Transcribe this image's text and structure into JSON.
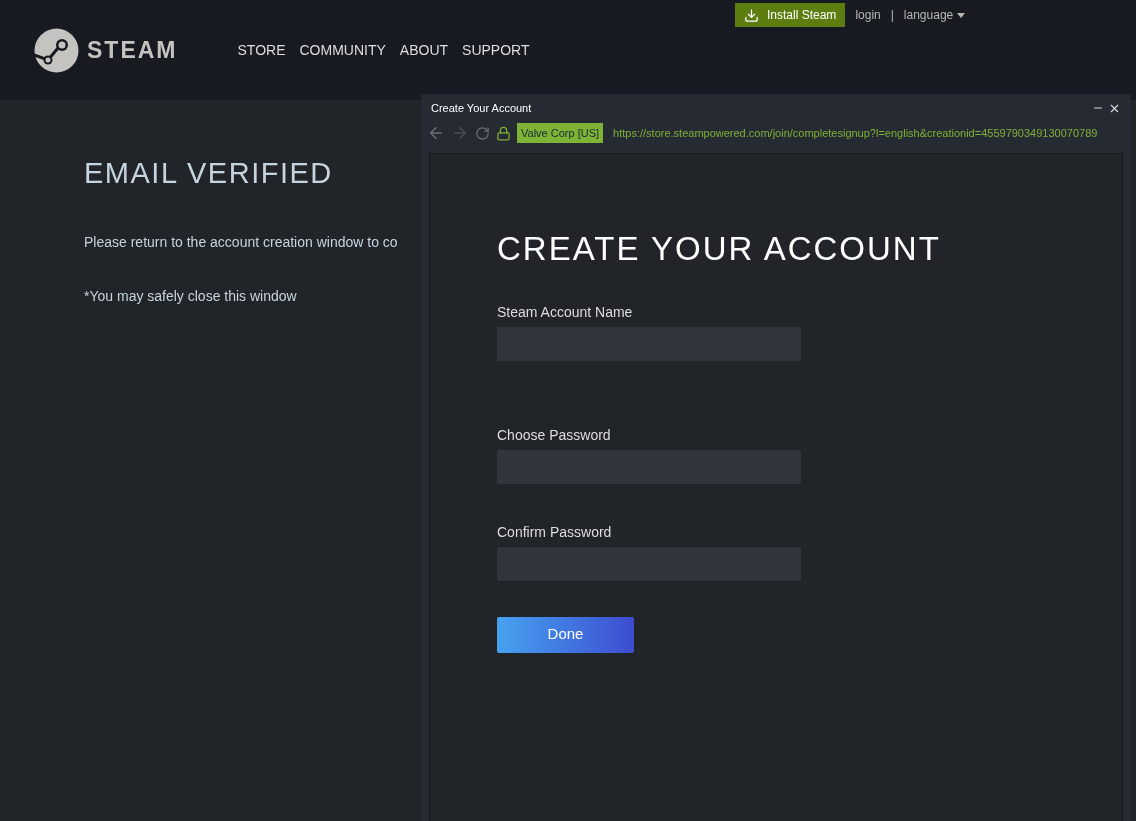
{
  "header": {
    "logo_text": "STEAM",
    "nav": [
      "STORE",
      "COMMUNITY",
      "ABOUT",
      "SUPPORT"
    ],
    "install_button": "Install Steam",
    "login": "login",
    "separator": "|",
    "language": "language"
  },
  "page": {
    "title": "EMAIL VERIFIED",
    "message": "Please return to the account creation window to co",
    "note": "*You may safely close this window"
  },
  "popup": {
    "title": "Create Your Account",
    "certificate": "Valve Corp [US]",
    "url": "https://store.steampowered.com/join/completesignup?l=english&creationid=4559790349130070789",
    "heading": "CREATE YOUR ACCOUNT",
    "fields": [
      {
        "label": "Steam Account Name"
      },
      {
        "label": "Choose Password"
      },
      {
        "label": "Confirm Password"
      }
    ],
    "done_button": "Done"
  }
}
